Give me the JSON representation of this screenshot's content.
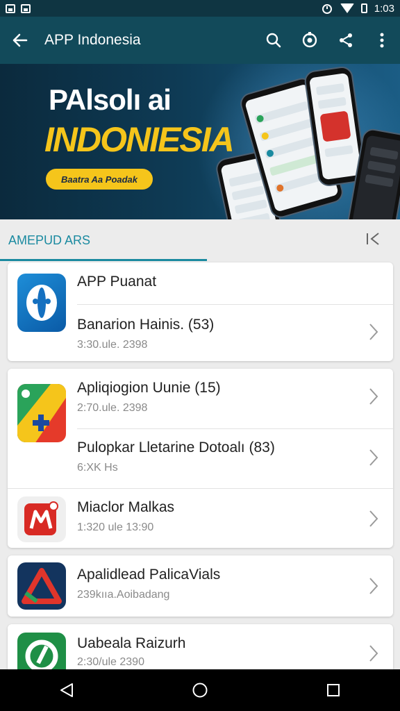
{
  "status_bar": {
    "time": "1:03",
    "left_icons": [
      "image-icon",
      "image-icon"
    ],
    "right_icons": [
      "alarm-icon",
      "wifi-icon",
      "battery-icon"
    ]
  },
  "app_bar": {
    "title": "APP Indonesia",
    "actions": [
      "search-icon",
      "settings-icon",
      "share-icon",
      "more-icon"
    ]
  },
  "banner": {
    "line1": "PAlsolı ai",
    "line2": "INDONIESIA",
    "button": "Baatra Aa Poadak"
  },
  "tab": {
    "label": "AMEPUD ARS"
  },
  "cards": [
    {
      "rows": [
        {
          "name": "APP Puanat",
          "meta": ""
        },
        {
          "name": "Banarion Hainis. (53)",
          "meta": "3:30.ule. 2398"
        }
      ]
    },
    {
      "rows": [
        {
          "name": "Apliqiogion Uunie (15)",
          "meta": "2:70.ule. 2398"
        },
        {
          "name": "Pulopkar Lletarine Dotoalı (83)",
          "meta": "6:XK Hs"
        }
      ]
    },
    {
      "rows": [
        {
          "name": "Miaclor Malkas",
          "meta": "1:320 ule 13:90"
        }
      ]
    },
    {
      "rows": [
        {
          "name": "Apalidlead PalicaVials",
          "meta": "239kııa.Aoibadang"
        }
      ]
    },
    {
      "rows": [
        {
          "name": "Uabeala Raizurh",
          "meta": "2:30/ule 2390"
        }
      ]
    }
  ],
  "colors": {
    "app_bar": "#124a5a",
    "accent": "#1a8aa0",
    "banner_yellow": "#f5c51b"
  }
}
